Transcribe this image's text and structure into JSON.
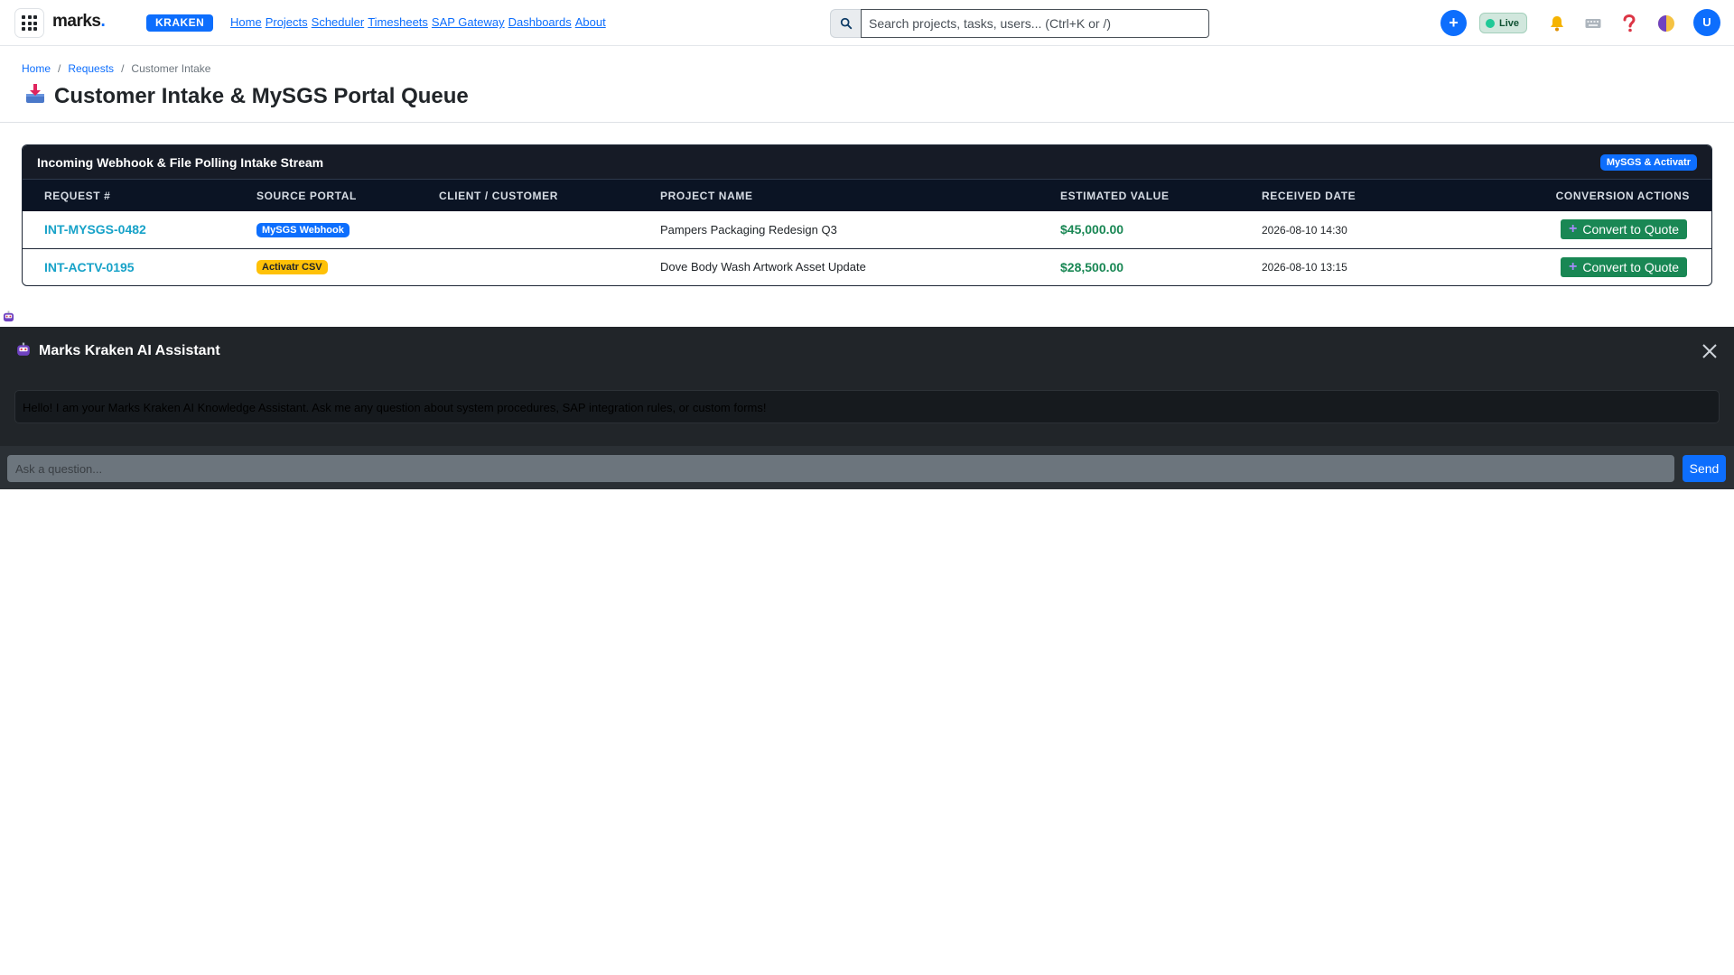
{
  "nav": {
    "brand": "marks",
    "brand_dot": ".",
    "badge": "KRAKEN",
    "links": [
      "Home",
      "Projects",
      "Scheduler",
      "Timesheets",
      "SAP Gateway",
      "Dashboards",
      "About"
    ],
    "search_placeholder": "Search projects, tasks, users... (Ctrl+K or /)",
    "add_label": "+",
    "live_label": "Live",
    "avatar_initial": "U"
  },
  "breadcrumb": {
    "home": "Home",
    "requests": "Requests",
    "current": "Customer Intake"
  },
  "page": {
    "title": "Customer Intake & MySGS Portal Queue"
  },
  "intake": {
    "title": "Incoming Webhook & File Polling Intake Stream",
    "badge": "MySGS & Activatr",
    "columns": [
      "REQUEST #",
      "SOURCE PORTAL",
      "CLIENT / CUSTOMER",
      "PROJECT NAME",
      "ESTIMATED VALUE",
      "RECEIVED DATE",
      "CONVERSION ACTIONS"
    ],
    "rows": [
      {
        "request": "INT-MYSGS-0482",
        "source": "MySGS Webhook",
        "client": "",
        "project": "Pampers Packaging Redesign Q3",
        "value": "$45,000.00",
        "date": "2026-08-10 14:30",
        "action": "Convert to Quote"
      },
      {
        "request": "INT-ACTV-0195",
        "source": "Activatr CSV",
        "client": "",
        "project": "Dove Body Wash Artwork Asset Update",
        "value": "$28,500.00",
        "date": "2026-08-10 13:15",
        "action": "Convert to Quote"
      }
    ]
  },
  "assistant": {
    "title": "Marks Kraken AI Assistant",
    "message": "Hello! I am your Marks Kraken AI Knowledge Assistant. Ask me any question about system procedures, SAP integration rules, or custom forms!",
    "input_placeholder": "Ask a question...",
    "send_label": "Send"
  },
  "colors": {
    "primary": "#0d6efd",
    "success": "#198754",
    "warning": "#ffc107",
    "dark": "#212529",
    "link_cyan": "#17a2c8"
  }
}
